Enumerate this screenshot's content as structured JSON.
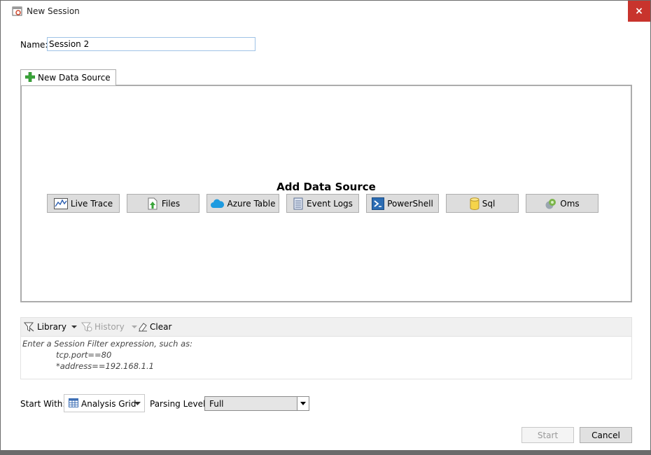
{
  "window": {
    "title": "New Session",
    "close_glyph": "×"
  },
  "name": {
    "label": "Name:",
    "value": "Session 2"
  },
  "tab": {
    "label": "New Data Source",
    "icon": "plus-icon"
  },
  "data_source": {
    "title": "Add Data Source",
    "buttons": [
      {
        "label": "Live Trace",
        "icon": "live-trace-icon"
      },
      {
        "label": "Files",
        "icon": "files-upload-icon"
      },
      {
        "label": "Azure Table",
        "icon": "cloud-icon"
      },
      {
        "label": "Event Logs",
        "icon": "event-log-icon"
      },
      {
        "label": "PowerShell",
        "icon": "powershell-icon"
      },
      {
        "label": "Sql",
        "icon": "database-icon"
      },
      {
        "label": "Oms",
        "icon": "oms-icon"
      }
    ]
  },
  "filter": {
    "toolbar": {
      "library": "Library",
      "history": "History",
      "clear": "Clear"
    },
    "hint": "Enter a Session Filter expression, such as:",
    "examples": [
      "tcp.port==80",
      "*address==192.168.1.1"
    ]
  },
  "start_with": {
    "label": "Start With:",
    "value": "Analysis Grid"
  },
  "parsing": {
    "label": "Parsing Level:",
    "value": "Full"
  },
  "actions": {
    "start": "Start",
    "cancel": "Cancel"
  },
  "colors": {
    "close_red": "#c8342d",
    "input_border": "#9fc3e6",
    "button_face": "#dddddd"
  }
}
